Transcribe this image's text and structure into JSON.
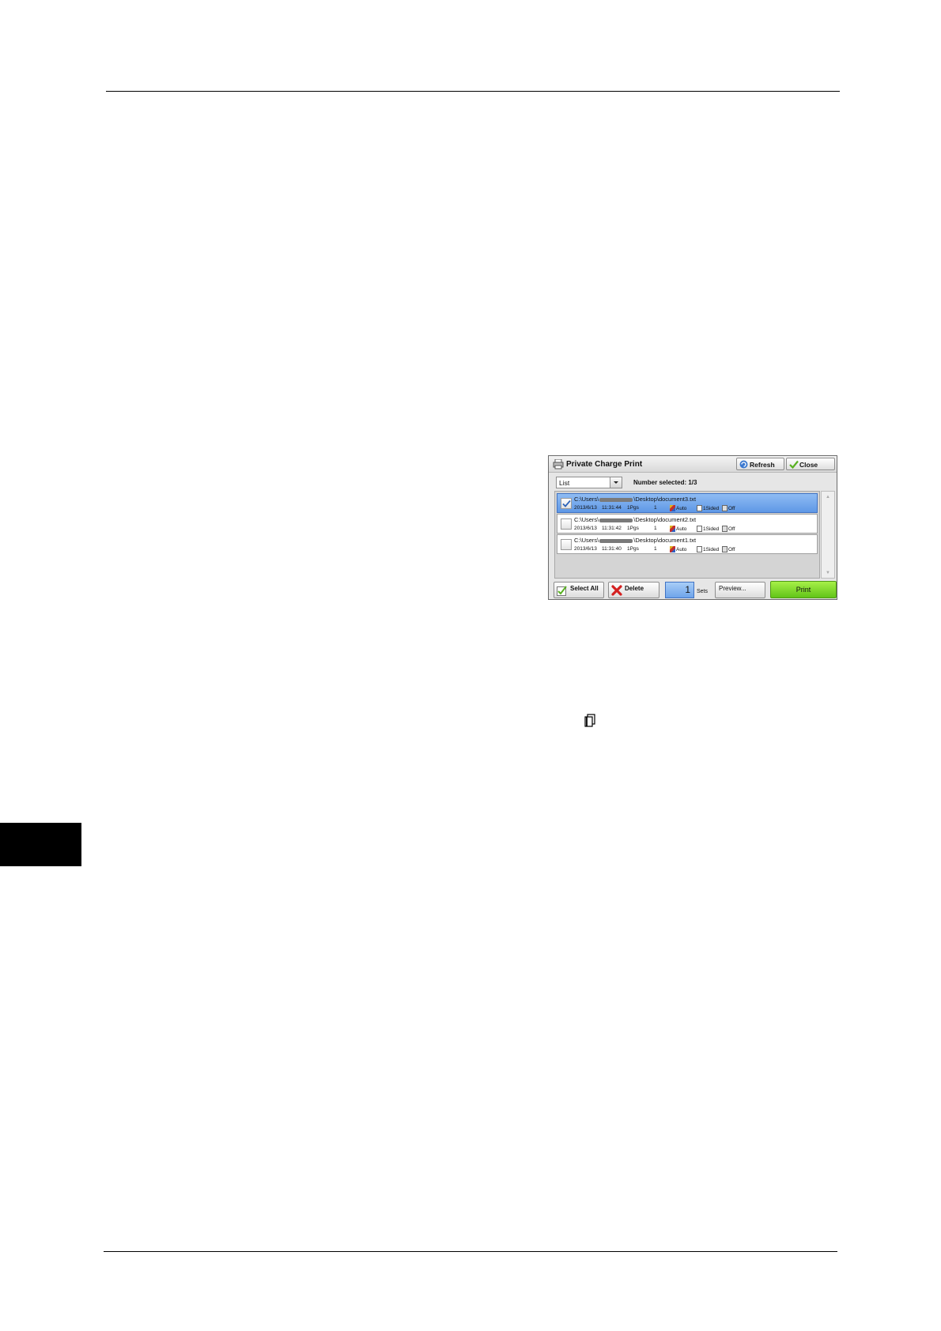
{
  "panel": {
    "title": "Private Charge Print",
    "refresh_label": "Refresh",
    "close_label": "Close",
    "view_select_value": "List",
    "number_selected": "Number selected: 1/3",
    "jobs": [
      {
        "path_prefix": "C:\\Users\\",
        "path_suffix": "\\Desktop\\document3.txt",
        "date": "2013/6/13",
        "time": "11:31:44",
        "pages": "1Pgs",
        "quantity": "1",
        "color": "Auto",
        "sides": "1Sided",
        "staple": "Off",
        "selected": true
      },
      {
        "path_prefix": "C:\\Users\\",
        "path_suffix": "\\Desktop\\document2.txt",
        "date": "2013/6/13",
        "time": "11:31:42",
        "pages": "1Pgs",
        "quantity": "1",
        "color": "Auto",
        "sides": "1Sided",
        "staple": "Off",
        "selected": false
      },
      {
        "path_prefix": "C:\\Users\\",
        "path_suffix": "\\Desktop\\document1.txt",
        "date": "2013/6/13",
        "time": "11:31:40",
        "pages": "1Pgs",
        "quantity": "1",
        "color": "Auto",
        "sides": "1Sided",
        "staple": "Off",
        "selected": false
      }
    ],
    "select_all_label": "Select All",
    "delete_label": "Delete",
    "sets_value": "1",
    "sets_label": "Sets",
    "preview_label": "Preview...",
    "print_label": "Print",
    "colors": {
      "selected_row": "#5f98e6",
      "print_button": "#62c418",
      "delete_icon": "#d42020"
    }
  }
}
